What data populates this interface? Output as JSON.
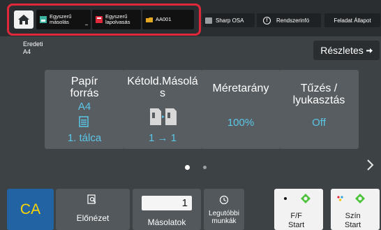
{
  "topbar": {
    "home": "home-icon",
    "shortcuts": [
      {
        "label_line1": "Egyszerű",
        "label_line2": "másolás",
        "icon": "copier-icon"
      },
      {
        "label_line1": "Egyszerű",
        "label_line2": "lapolvasás",
        "icon": "scan-icon"
      },
      {
        "label": "AA001",
        "icon": "folder-icon"
      }
    ],
    "sharp_osa": "Sharp OSA",
    "system_info": "Rendszerinfó",
    "job_status": "Feladat Állapot"
  },
  "original": {
    "label": "Eredeti",
    "value": "A4"
  },
  "details_button": "Részletes",
  "tiles": {
    "paper": {
      "title_line1": "Papír",
      "title_line2": "forrás",
      "size": "A4",
      "tray": "1. tálca"
    },
    "duplex": {
      "title_line1": "Kétold.Másolá",
      "title_line2": "s",
      "value": "1 → 1"
    },
    "ratio": {
      "title": "Méretarány",
      "value": "100%"
    },
    "staple": {
      "title_line1": "Tűzés /",
      "title_line2": "lyukasztás",
      "value": "Off"
    }
  },
  "pager": {
    "current": 1,
    "total": 2
  },
  "bottom": {
    "ca": "CA",
    "preview": "Előnézet",
    "copies_value": "1",
    "copies_label": "Másolatok",
    "recent_line1": "Legutóbbi",
    "recent_line2": "munkák",
    "bw_line1": "F/F",
    "bw_line2": "Start",
    "color_line1": "Szín",
    "color_line2": "Start"
  },
  "colors": {
    "accent_blue": "#5bc7e8",
    "ca_blue": "#2264a3",
    "ca_text": "#ffd600",
    "highlight_red": "#e0283b",
    "start_green": "#4cc23a"
  }
}
